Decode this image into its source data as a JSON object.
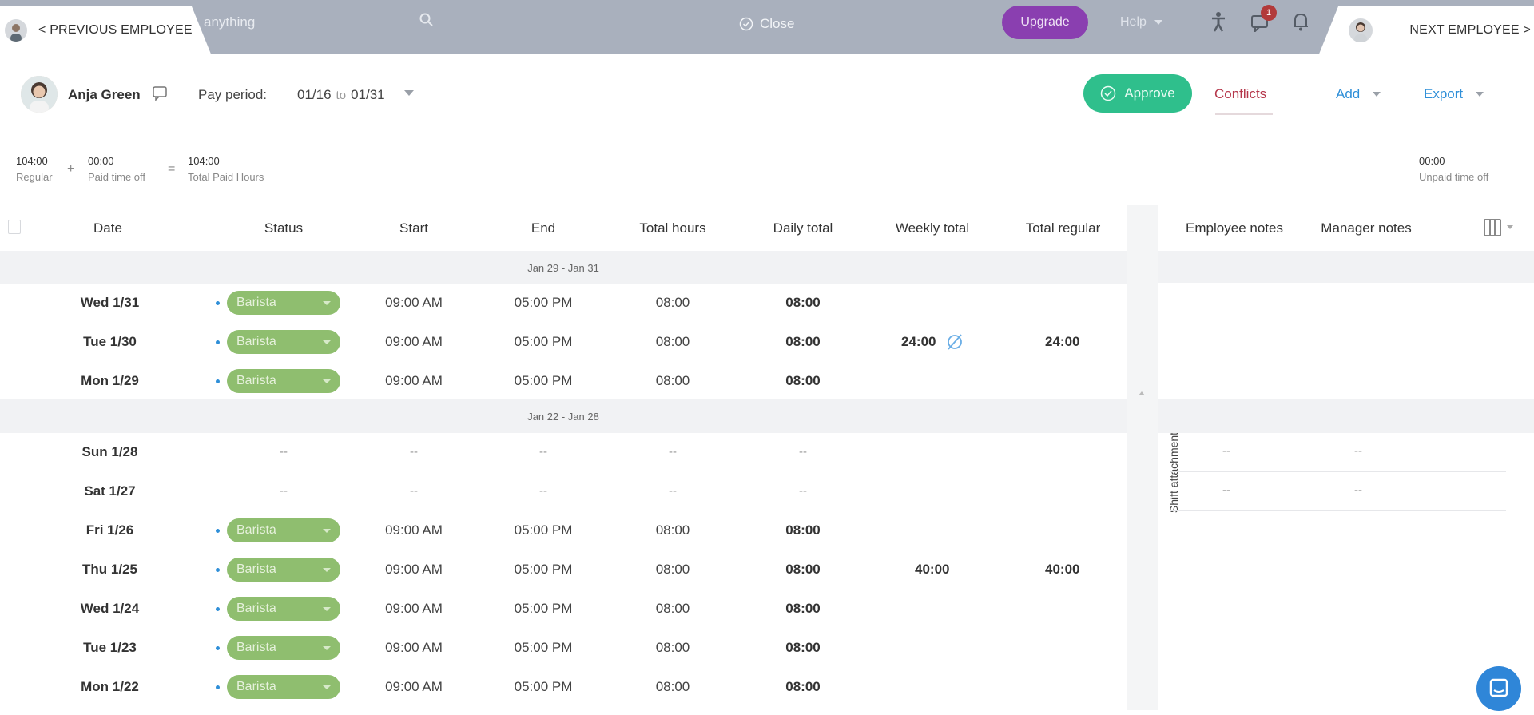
{
  "topbar": {
    "search_partial": "anything",
    "close_label": "Close",
    "upgrade_label": "Upgrade",
    "help_label": "Help",
    "notification_count": "1",
    "prev_employee": "< PREVIOUS EMPLOYEE",
    "next_employee": "NEXT EMPLOYEE >"
  },
  "employee": {
    "name": "Anja Green",
    "pay_period_label": "Pay period:",
    "period_start": "01/16",
    "period_to": "to",
    "period_end": "01/31"
  },
  "actions": {
    "approve": "Approve",
    "conflicts": "Conflicts",
    "add": "Add",
    "export": "Export"
  },
  "summary": {
    "regular_value": "104:00",
    "regular_label": "Regular",
    "plus": "+",
    "pto_value": "00:00",
    "pto_label": "Paid time off",
    "equals": "=",
    "total_value": "104:00",
    "total_label": "Total Paid Hours",
    "unpaid_value": "00:00",
    "unpaid_label": "Unpaid time off"
  },
  "columns": {
    "date": "Date",
    "status": "Status",
    "start": "Start",
    "end": "End",
    "total_hours": "Total hours",
    "daily_total": "Daily total",
    "weekly_total": "Weekly total",
    "total_regular": "Total regular",
    "employee_notes": "Employee notes",
    "manager_notes": "Manager notes"
  },
  "attachments_label": "Shift attachments",
  "weeks": [
    {
      "range": "Jan 29 - Jan 31",
      "weekly_total": "24:00",
      "total_regular": "24:00",
      "rows": [
        {
          "date": "Wed 1/31",
          "status": "Barista",
          "start": "09:00 AM",
          "end": "05:00 PM",
          "total": "08:00",
          "daily": "08:00"
        },
        {
          "date": "Tue 1/30",
          "status": "Barista",
          "start": "09:00 AM",
          "end": "05:00 PM",
          "total": "08:00",
          "daily": "08:00"
        },
        {
          "date": "Mon 1/29",
          "status": "Barista",
          "start": "09:00 AM",
          "end": "05:00 PM",
          "total": "08:00",
          "daily": "08:00"
        }
      ]
    },
    {
      "range": "Jan 22 - Jan 28",
      "weekly_total": "40:00",
      "total_regular": "40:00",
      "rows": [
        {
          "date": "Sun 1/28",
          "status": "--",
          "start": "--",
          "end": "--",
          "total": "--",
          "daily": "--",
          "emp_note": "--",
          "mgr_note": "--"
        },
        {
          "date": "Sat 1/27",
          "status": "--",
          "start": "--",
          "end": "--",
          "total": "--",
          "daily": "--",
          "emp_note": "--",
          "mgr_note": "--"
        },
        {
          "date": "Fri 1/26",
          "status": "Barista",
          "start": "09:00 AM",
          "end": "05:00 PM",
          "total": "08:00",
          "daily": "08:00"
        },
        {
          "date": "Thu 1/25",
          "status": "Barista",
          "start": "09:00 AM",
          "end": "05:00 PM",
          "total": "08:00",
          "daily": "08:00"
        },
        {
          "date": "Wed 1/24",
          "status": "Barista",
          "start": "09:00 AM",
          "end": "05:00 PM",
          "total": "08:00",
          "daily": "08:00"
        },
        {
          "date": "Tue 1/23",
          "status": "Barista",
          "start": "09:00 AM",
          "end": "05:00 PM",
          "total": "08:00",
          "daily": "08:00"
        },
        {
          "date": "Mon 1/22",
          "status": "Barista",
          "start": "09:00 AM",
          "end": "05:00 PM",
          "total": "08:00",
          "daily": "08:00"
        }
      ]
    }
  ],
  "colors": {
    "topbar": "#a9b0bd",
    "upgrade": "#8a3fb0",
    "approve": "#2fbf8c",
    "conflicts": "#b5374b",
    "link": "#2f8fd8",
    "status_pill": "#8fbe6f"
  }
}
